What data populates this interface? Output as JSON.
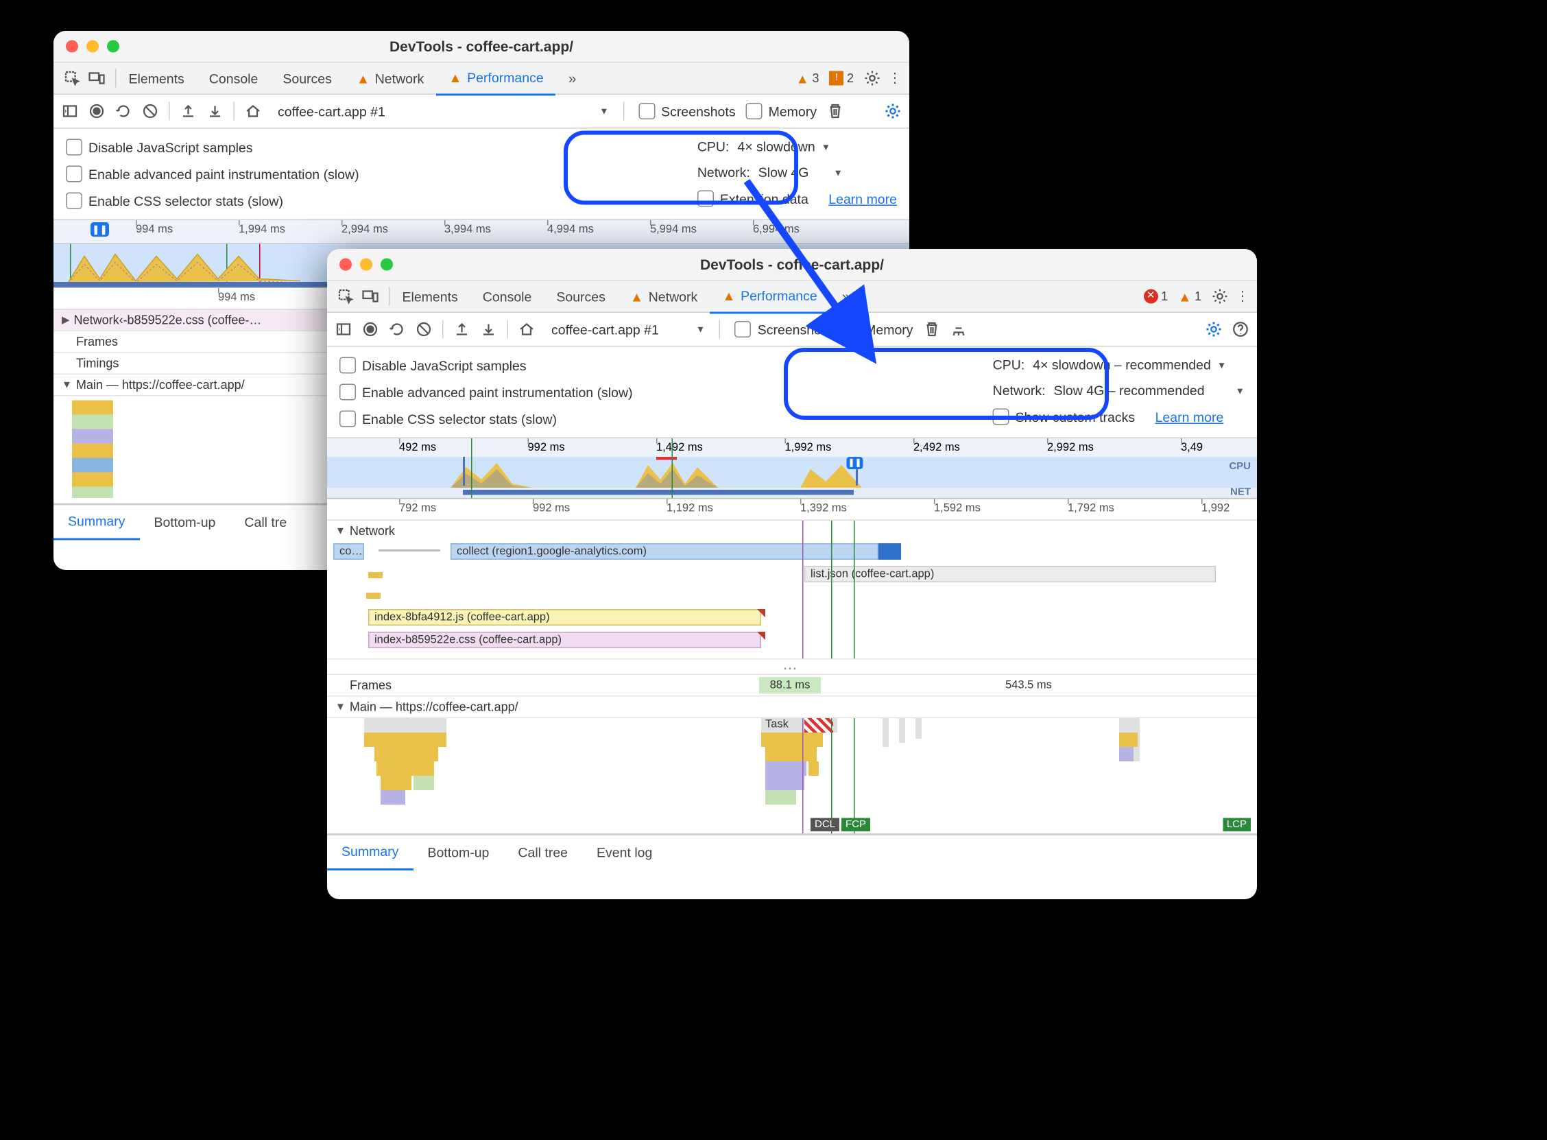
{
  "common": {
    "title": "DevTools - coffee-cart.app/",
    "tabs": {
      "elements": "Elements",
      "console": "Console",
      "sources": "Sources",
      "network": "Network",
      "performance": "Performance"
    },
    "toolbar": {
      "session": "coffee-cart.app #1",
      "screenshots": "Screenshots",
      "memory": "Memory"
    },
    "opts": {
      "disable_js": "Disable JavaScript samples",
      "paint": "Enable advanced paint instrumentation (slow)",
      "css": "Enable CSS selector stats (slow)",
      "cpu_label": "CPU:",
      "net_label": "Network:",
      "learn": "Learn more"
    },
    "btabs": {
      "summary": "Summary",
      "bottomup": "Bottom-up",
      "calltree": "Call tree",
      "eventlog": "Event log"
    },
    "tracks": {
      "network": "Network",
      "frames": "Frames",
      "timings": "Timings",
      "main": "Main — https://coffee-cart.app/"
    }
  },
  "win1": {
    "warnings": {
      "tri": "3",
      "box": "2"
    },
    "throttle": {
      "cpu": "4× slowdown",
      "net": "Slow 4G"
    },
    "ext_data": "Extension data",
    "overview_ticks": [
      "994 ms",
      "1,994 ms",
      "2,994 ms",
      "3,994 ms",
      "4,994 ms",
      "5,994 ms",
      "6,994 ms"
    ],
    "detail_ticks": [
      "994 ms"
    ],
    "net_row": "Network‹-b859522e.css (coffee-…",
    "calltree_trunc": "Call tre"
  },
  "win2": {
    "warnings": {
      "err": "1",
      "tri": "1"
    },
    "throttle": {
      "cpu": "4× slowdown – recommended",
      "net": "Slow 4G – recommended"
    },
    "custom": "Show custom tracks",
    "overview_ticks": [
      "492 ms",
      "992 ms",
      "1,492 ms",
      "1,992 ms",
      "2,492 ms",
      "2,992 ms",
      "3,49"
    ],
    "overview_labels": {
      "cpu": "CPU",
      "net": "NET"
    },
    "detail_ticks": [
      "792 ms",
      "992 ms",
      "1,192 ms",
      "1,392 ms",
      "1,592 ms",
      "1,792 ms",
      "1,992"
    ],
    "network_rows": {
      "co": "co…",
      "collect": "collect (region1.google-analytics.com)",
      "list": "list.json (coffee-cart.app)",
      "js": "index-8bfa4912.js (coffee-cart.app)",
      "css": "index-b859522e.css (coffee-cart.app)"
    },
    "frames": {
      "a": "88.1 ms",
      "b": "543.5 ms"
    },
    "main": {
      "task": "Task"
    },
    "markers": {
      "dcl": "DCL",
      "fcp": "FCP",
      "lcp": "LCP"
    }
  }
}
